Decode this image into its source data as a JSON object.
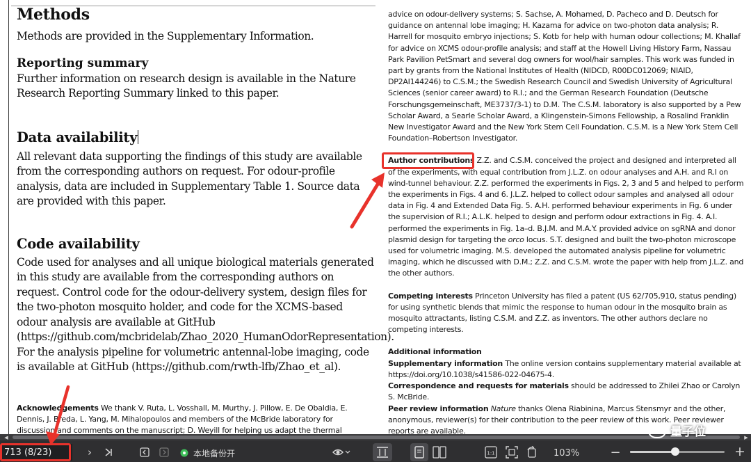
{
  "left": {
    "methods_title": "Methods",
    "methods_text": "Methods are provided in the Supplementary Information.",
    "reporting_title": "Reporting summary",
    "reporting_text": "Further information on research design is available in the Nature Research Reporting Summary linked to this paper.",
    "data_title": "Data availability",
    "data_text": "All relevant data supporting the findings of this study are available from the corresponding authors on request. For odour-profile analysis, data are included in Supplementary Table 1. Source data are provided with this paper.",
    "code_title": "Code availability",
    "code_text": "Code used for analyses and all unique biological materials generated in this study are available from the corresponding authors on request. Control code for the odour-delivery system, design files for the two-photon mosquito holder, and code for the XCMS-based odour analysis are available at GitHub (https://github.com/mcbridelab/Zhao_2020_HumanOdorRepresentation). For the analysis pipeline for volumetric antennal-lobe imaging, code is available at GitHub (https://github.com/rwth-lfb/Zhao_et_al).",
    "ack_label": "Acknowledgements",
    "ack_text": " We thank V. Ruta, L. Vosshall, M. Murthy, J. Pillow, E. De Obaldia, E. Dennis, J. Breda, L. Yang, M. Mihalopoulos and members of the McBride laboratory for discussion and comments on the manuscript; D. Weyill for helping us adapt the thermal"
  },
  "right": {
    "funding_text": "advice on odour-delivery systems; S. Sachse, A. Mohamed, D. Pacheco and D. Deutsch for guidance on antennal lobe imaging; H. Kazama for advice on two-photon data analysis; R. Harrell for mosquito embryo injections; S. Kotb for help with human odour collections; M. Khallaf for advice on XCMS odour-profile analysis; and staff at the Howell Living History Farm, Nassau Park Pavilion PetSmart and several dog owners for wool/hair samples. This work was funded in part by grants from the National Institutes of Health (NIDCD, R00DC012069; NIAID, DP2AI144246) to C.S.M.; the Swedish Research Council and Swedish University of Agricultural Sciences (senior career award) to R.I.; and the German Research Foundation (Deutsche Forschungsgemeinschaft, ME3737/3-1) to D.M. The C.S.M. laboratory is also supported by a Pew Scholar Award, a Searle Scholar Award, a Klingenstein-Simons Fellowship, a Rosalind Franklin New Investigator Award and the New York Stem Cell Foundation. C.S.M. is a New York Stem Cell Foundation–Robertson Investigator.",
    "contrib_label": "Author contributions",
    "contrib_text_a": " Z.Z. and C.S.M. conceived the project and designed and interpreted all of the experiments, with equal contribution from J.L.Z. on odour analyses and A.H. and R.I on wind-tunnel behaviour. Z.Z. performed the experiments in Figs. 2, 3 and 5 and helped to perform the experiments in Figs. 4 and 6. J.L.Z. helped to collect odour samples and analysed all odour data in Fig. 4 and Extended Data Fig. 5. A.H. performed behaviour experiments in Fig. 6 under the supervision of R.I.; A.L.K. helped to design and perform odour extractions in Fig. 4. A.I. performed the experiments in Fig. 1a–d. B.J.M. and M.A.Y. provided advice on sgRNA and donor plasmid design for targeting the ",
    "contrib_orco": "orco",
    "contrib_text_b": " locus. S.T. designed and built the two-photon microscope used for volumetric imaging. M.S. developed the automated analysis pipeline for volumetric imaging, which he discussed with D.M.; Z.Z. and C.S.M. wrote the paper with help from J.L.Z. and the other authors.",
    "competing_label": "Competing interests",
    "competing_text": " Princeton University has filed a patent (US 62/705,910, status pending) for using synthetic blends that mimic the response to human odour in the mosquito brain as mosquito attractants, listing C.S.M. and Z.Z. as inventors. The other authors declare no competing interests.",
    "additional_title": "Additional information",
    "supp_label": "Supplementary information",
    "supp_text": " The online version contains supplementary material available at https://doi.org/10.1038/s41586-022-04675-4.",
    "corr_label": "Correspondence and requests for materials",
    "corr_text": " should be addressed to Zhilei Zhao or Carolyn S. McBride.",
    "peer_label": "Peer review information",
    "peer_journal": "Nature",
    "peer_text": " thanks Olena Riabinina, Marcus Stensmyr and the other, anonymous, reviewer(s) for their contribution to the peer review of this work. Peer reviewer reports are available."
  },
  "toolbar": {
    "page_indicator": "713 (8/23)",
    "backup_label": "本地备份开",
    "zoom": "103%",
    "zoom_level_fraction": 0.48,
    "watermark_text": "量子位"
  },
  "colors": {
    "annotation_red": "#e8322b",
    "toolbar_bg": "#2f2f31",
    "backup_green": "#3fbf5a"
  }
}
